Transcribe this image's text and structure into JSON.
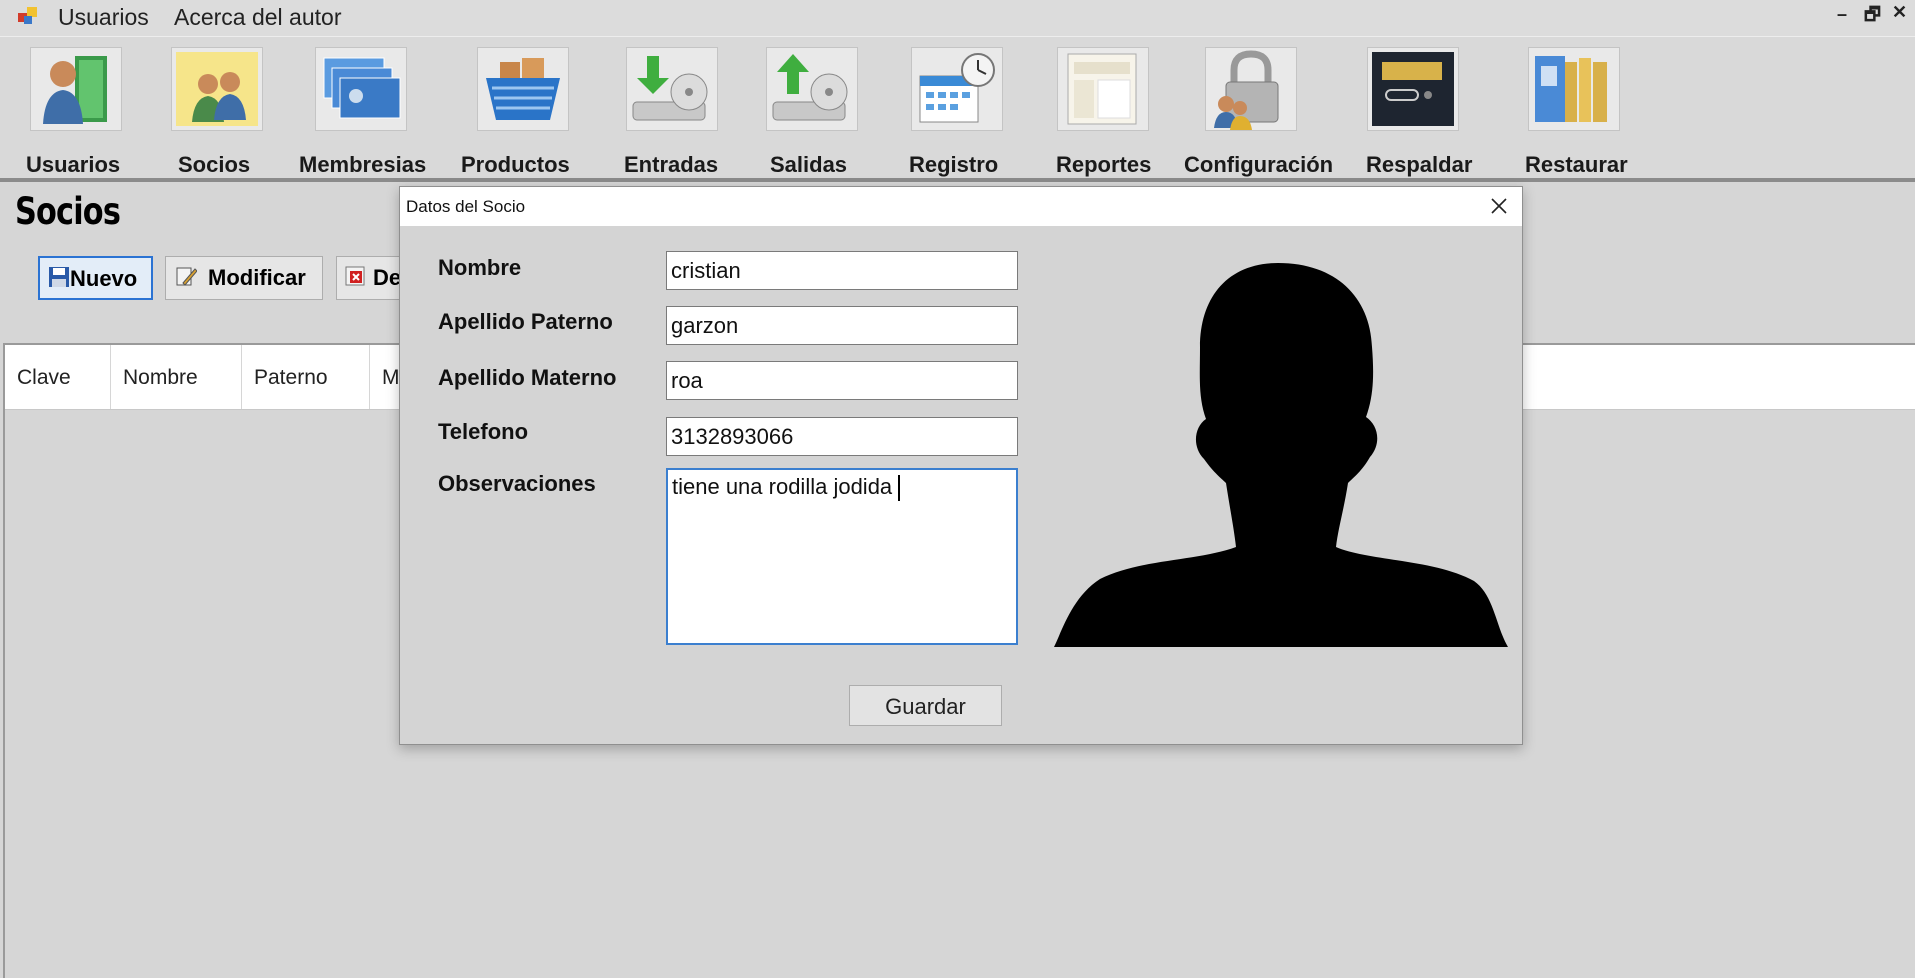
{
  "menu": {
    "items": [
      "Usuarios",
      "Acerca del autor"
    ]
  },
  "toolbar": {
    "buttons": [
      {
        "label": "Usuarios",
        "icon": "users-book-icon"
      },
      {
        "label": "Socios",
        "icon": "partners-icon"
      },
      {
        "label": "Membresias",
        "icon": "membership-cards-icon"
      },
      {
        "label": "Productos",
        "icon": "shopping-basket-icon"
      },
      {
        "label": "Entradas",
        "icon": "disk-in-icon"
      },
      {
        "label": "Salidas",
        "icon": "disk-out-icon"
      },
      {
        "label": "Registro",
        "icon": "calendar-clock-icon"
      },
      {
        "label": "Reportes",
        "icon": "report-icon"
      },
      {
        "label": "Configuración",
        "icon": "lock-user-icon"
      },
      {
        "label": "Respaldar",
        "icon": "memory-card-icon"
      },
      {
        "label": "Restaurar",
        "icon": "folders-icon"
      }
    ]
  },
  "page": {
    "title": "Socios",
    "actions": {
      "new": "Nuevo",
      "edit": "Modificar",
      "delete_partial": "De"
    }
  },
  "grid": {
    "columns": [
      "Clave",
      "Nombre",
      "Paterno",
      "Ma"
    ]
  },
  "dialog": {
    "title": "Datos del Socio",
    "labels": {
      "nombre": "Nombre",
      "paterno": "Apellido Paterno",
      "materno": "Apellido Materno",
      "telefono": "Telefono",
      "observaciones": "Observaciones"
    },
    "values": {
      "nombre": "cristian",
      "paterno": "garzon",
      "materno": "roa",
      "telefono": "3132893066",
      "observaciones": "tiene una rodilla jodida"
    },
    "save_label": "Guardar"
  }
}
